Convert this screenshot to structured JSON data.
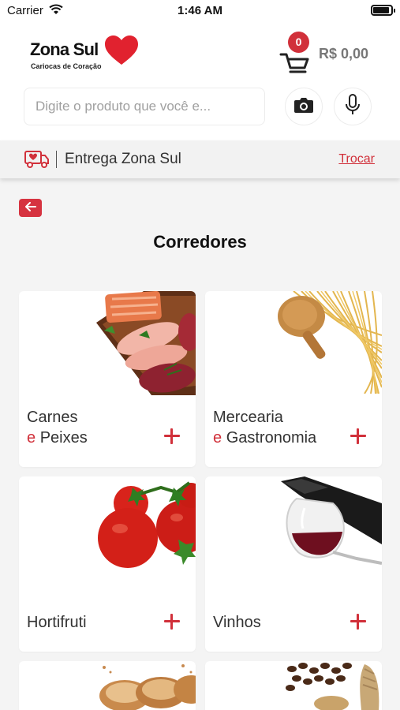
{
  "status_bar": {
    "carrier": "Carrier",
    "time": "1:46 AM"
  },
  "brand": {
    "name": "Zona Sul",
    "tagline": "Cariocas de Coração",
    "color": "#d1303a"
  },
  "cart": {
    "count": "0",
    "total": "R$ 0,00"
  },
  "search": {
    "placeholder": "Digite o produto que você e..."
  },
  "icons": {
    "camera": "camera-icon",
    "mic": "microphone-icon",
    "delivery": "delivery-truck-icon",
    "back": "arrow-left-icon",
    "add": "plus-icon"
  },
  "delivery": {
    "label": "Entrega Zona Sul",
    "change_label": "Trocar"
  },
  "page": {
    "title": "Corredores"
  },
  "categories": [
    {
      "line1": "Carnes",
      "connector": "e",
      "line2": "Peixes"
    },
    {
      "line1": "Mercearia",
      "connector": "e",
      "line2": "Gastronomia"
    },
    {
      "line1": "Hortifruti"
    },
    {
      "line1": "Vinhos"
    },
    {
      "line1": ""
    },
    {
      "line1": ""
    }
  ]
}
